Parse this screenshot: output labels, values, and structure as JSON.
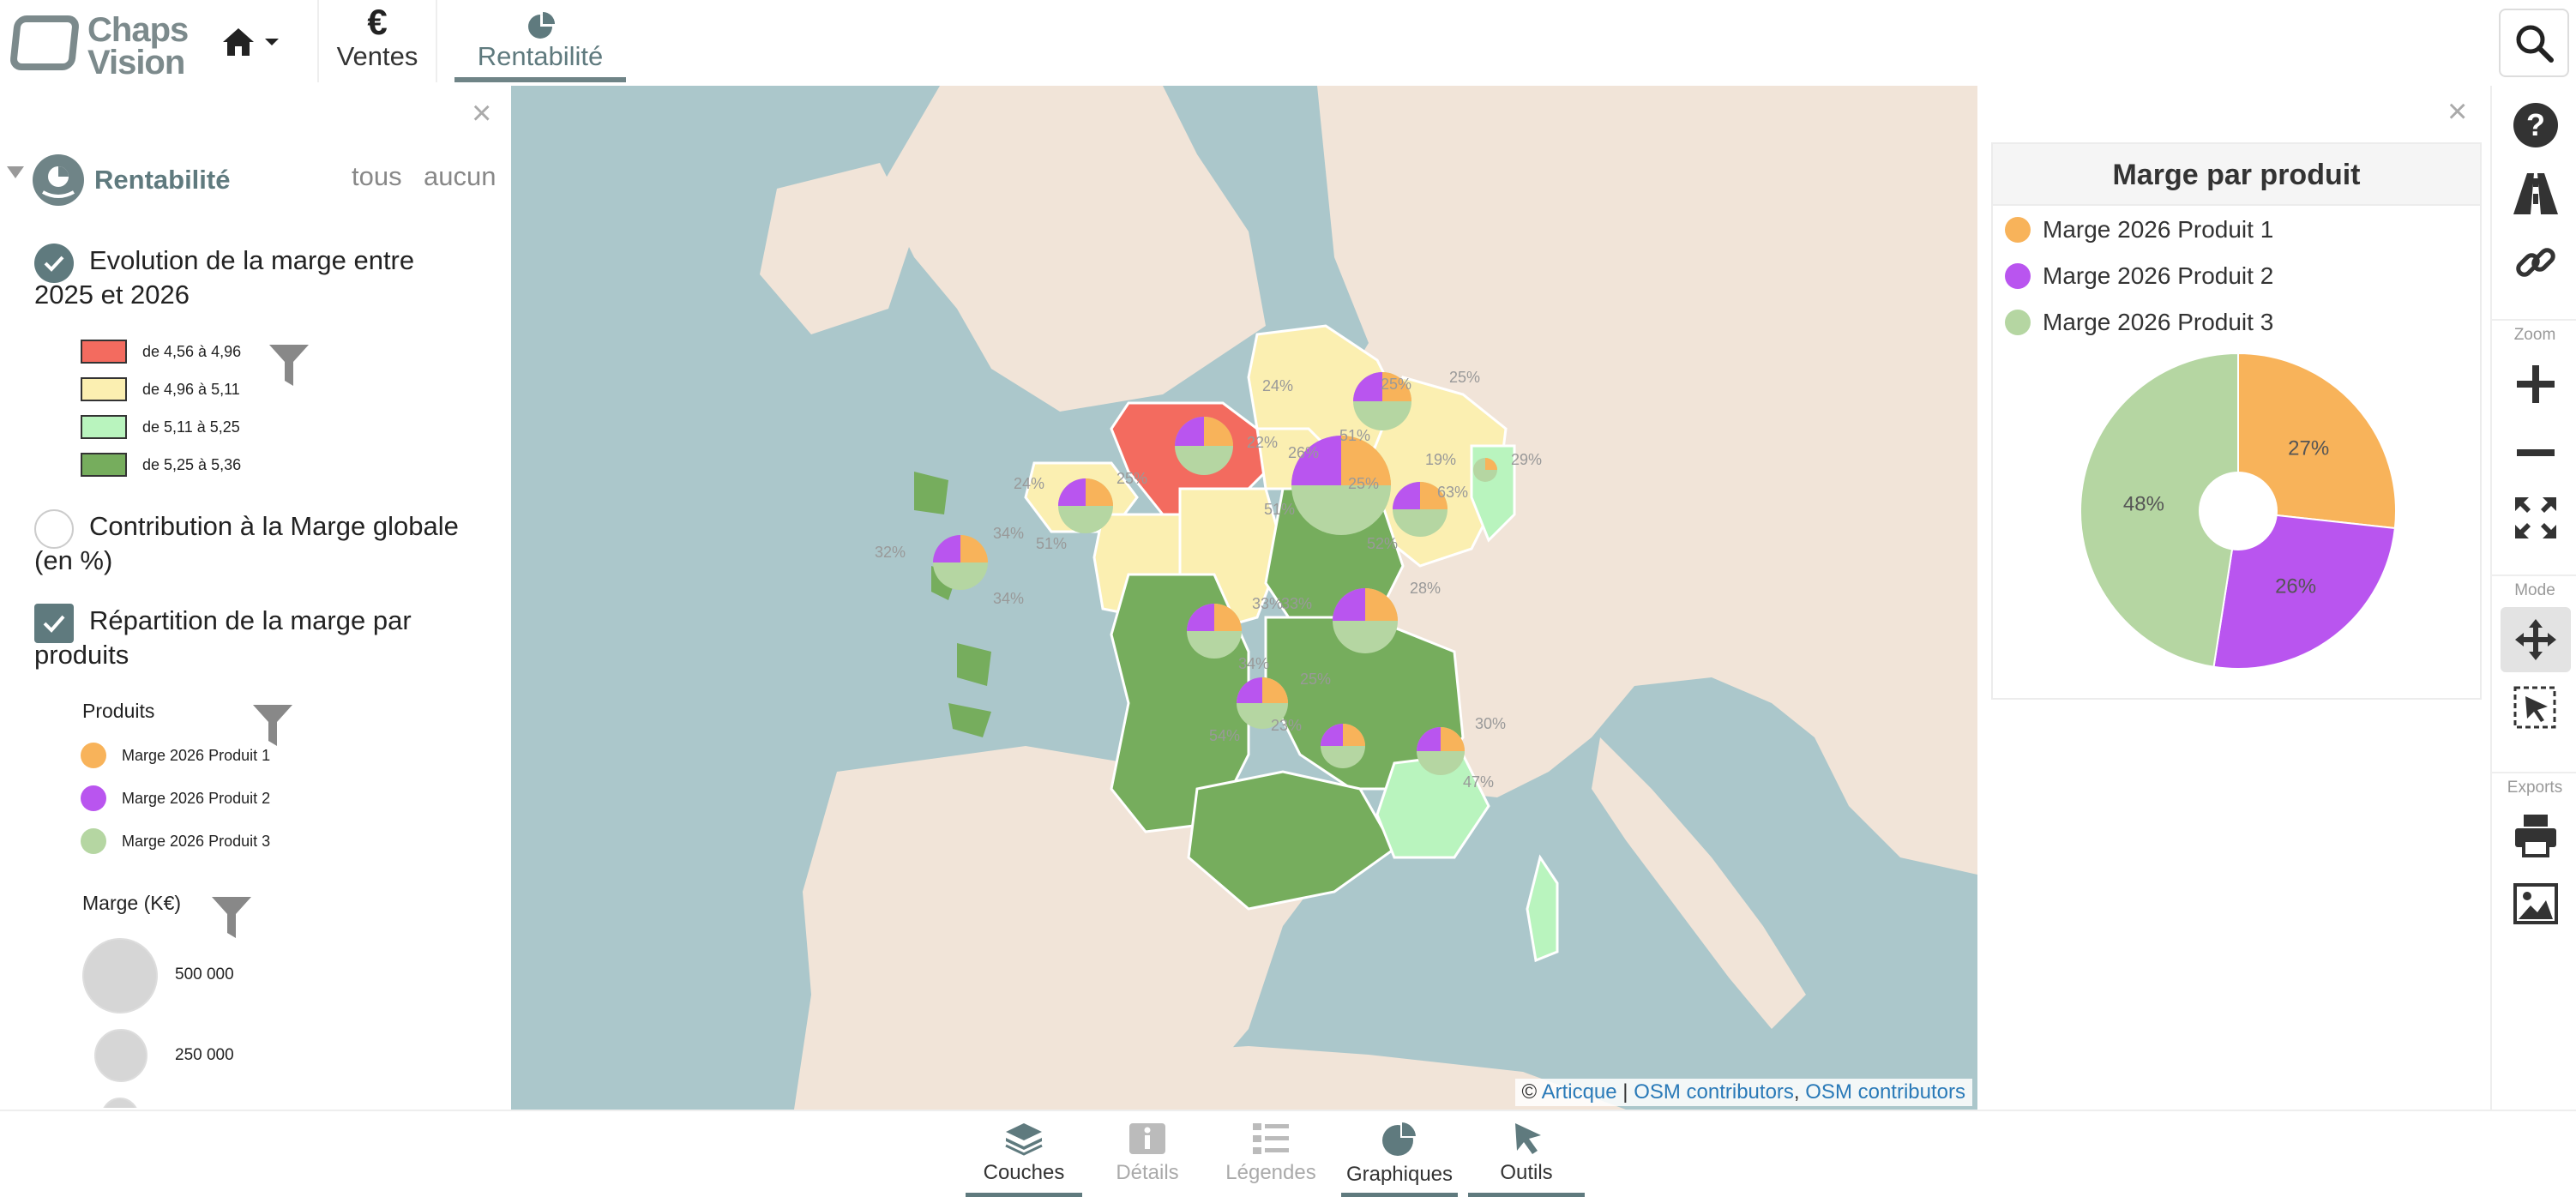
{
  "header": {
    "logo_line1": "Chaps",
    "logo_line2": "Vision",
    "tabs": [
      {
        "icon": "€",
        "label": "Ventes"
      },
      {
        "label": "Rentabilité",
        "active": true
      }
    ]
  },
  "layers_panel": {
    "group_title": "Rentabilité",
    "all_link": "tous",
    "none_link": "aucun",
    "layers": [
      {
        "label": "Evolution de la marge entre 2025 et 2026",
        "checked": true,
        "legend": [
          {
            "label": "de 4,56 à 4,96",
            "color": "#f36b5f"
          },
          {
            "label": "de 4,96 à 5,11",
            "color": "#fbefb1"
          },
          {
            "label": "de 5,11 à 5,25",
            "color": "#b9f4be"
          },
          {
            "label": "de 5,25 à 5,36",
            "color": "#76ad5d"
          }
        ]
      },
      {
        "label": "Contribution à la Marge globale (en %)",
        "checked": false
      },
      {
        "label": "Répartition de la marge par produits",
        "checked": true,
        "products_heading": "Produits",
        "legend": [
          {
            "label": "Marge 2026 Produit 1",
            "color": "#f8b35a"
          },
          {
            "label": "Marge 2026 Produit 2",
            "color": "#b955ef"
          },
          {
            "label": "Marge 2026 Produit 3",
            "color": "#b5d6a2"
          }
        ],
        "size_heading": "Marge (K€)",
        "size_legend": [
          {
            "label": "500 000"
          },
          {
            "label": "250 000"
          }
        ]
      }
    ]
  },
  "map": {
    "attribution_prefix": "©",
    "attribution_links": [
      "Articque",
      "OSM contributors",
      "OSM contributors"
    ],
    "pie_labels": [
      "24%",
      "25%",
      "25%",
      "51%",
      "24%",
      "25%",
      "51%",
      "26%",
      "22%",
      "51%",
      "19%",
      "63%",
      "29%",
      "25%",
      "52%",
      "28%",
      "32%",
      "34%",
      "34%",
      "33%",
      "33%",
      "34%",
      "25%",
      "23%",
      "54%",
      "30%",
      "47%"
    ]
  },
  "chart_panel": {
    "title": "Marge par produit",
    "legend": [
      {
        "label": "Marge 2026 Produit 1",
        "color": "#f8b35a"
      },
      {
        "label": "Marge 2026 Produit 2",
        "color": "#b955ef"
      },
      {
        "label": "Marge 2026 Produit 3",
        "color": "#b5d6a2"
      }
    ]
  },
  "chart_data": {
    "type": "pie",
    "title": "Marge par produit",
    "categories": [
      "Marge 2026 Produit 1",
      "Marge 2026 Produit 2",
      "Marge 2026 Produit 3"
    ],
    "values": [
      27,
      26,
      48
    ],
    "value_labels": [
      "27%",
      "26%",
      "48%"
    ],
    "colors": [
      "#f8b35a",
      "#b955ef",
      "#b5d6a2"
    ],
    "donut": true,
    "legend_position": "top"
  },
  "toolbar": {
    "zoom_label": "Zoom",
    "mode_label": "Mode",
    "exports_label": "Exports"
  },
  "bottom_tabs": [
    {
      "label": "Couches",
      "state": "active"
    },
    {
      "label": "Détails",
      "state": "disabled"
    },
    {
      "label": "Légendes",
      "state": "disabled"
    },
    {
      "label": "Graphiques",
      "state": "active"
    },
    {
      "label": "Outils",
      "state": "active"
    }
  ]
}
